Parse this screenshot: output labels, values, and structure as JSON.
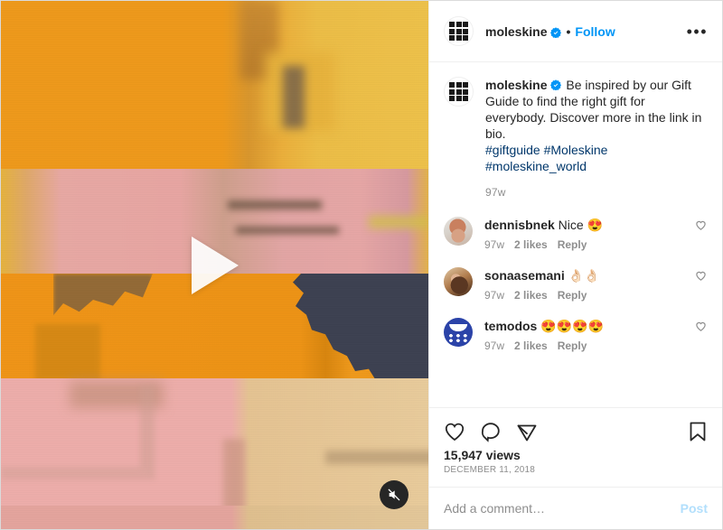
{
  "header": {
    "username": "moleskine",
    "verified_icon": "verified-badge-icon",
    "separator": "•",
    "follow_label": "Follow",
    "more_options_label": "•••",
    "avatar_icon": "moleskine-logo-icon"
  },
  "media": {
    "play_icon": "play-triangle-icon",
    "mute_icon": "mute-speaker-icon"
  },
  "caption": {
    "username": "moleskine",
    "text": " Be inspired by our Gift Guide to find the right gift for everybody. Discover more in the link in bio.",
    "hashtags": "#giftguide #Moleskine #moleskine_world",
    "timestamp": "97w"
  },
  "comments": [
    {
      "username": "dennisbnek",
      "text": " Nice 😍",
      "timestamp": "97w",
      "likes": "2 likes",
      "reply": "Reply",
      "avatar_icon": "dennisbnek-avatar",
      "like_icon": "heart-outline-icon"
    },
    {
      "username": "sonaasemani",
      "text": " 👌🏻👌🏻",
      "timestamp": "97w",
      "likes": "2 likes",
      "reply": "Reply",
      "avatar_icon": "sonaasemani-avatar",
      "like_icon": "heart-outline-icon"
    },
    {
      "username": "temodos",
      "text": " 😍😍😍😍",
      "timestamp": "97w",
      "likes": "2 likes",
      "reply": "Reply",
      "avatar_icon": "temodos-avatar",
      "like_icon": "heart-outline-icon"
    }
  ],
  "actions": {
    "like_icon": "heart-outline-icon",
    "comment_icon": "speech-bubble-icon",
    "share_icon": "paper-plane-icon",
    "save_icon": "bookmark-outline-icon",
    "views": "15,947 views",
    "date": "DECEMBER 11, 2018"
  },
  "add_comment": {
    "placeholder": "Add a comment…",
    "value": "",
    "post_label": "Post"
  },
  "colors": {
    "accent_blue": "#0095f6",
    "link_navy": "#00376b",
    "post_disabled": "#b2dffc",
    "text_primary": "#262626",
    "text_muted": "#8e8e8e",
    "border": "#efefef"
  }
}
